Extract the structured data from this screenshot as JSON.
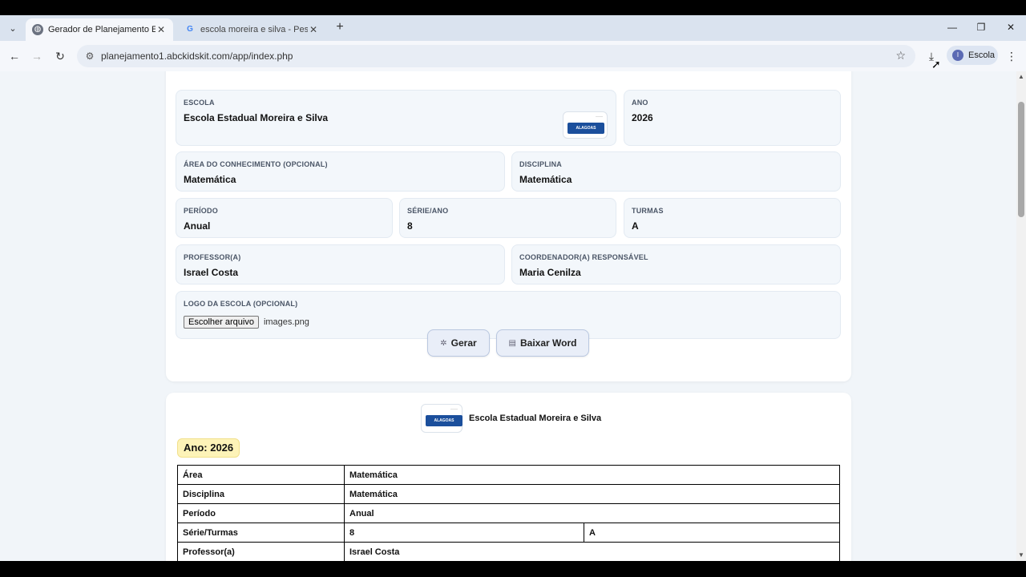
{
  "browser": {
    "tabs": [
      {
        "title": "Gerador de Planejamento Escolar",
        "icon": "globe-icon",
        "active": true
      },
      {
        "title": "escola moreira e silva - Pesquisa Google",
        "icon": "google-icon",
        "active": false
      }
    ],
    "url": "planejamento1.abckidskit.com/app/index.php",
    "profile_name": "Escola",
    "profile_initial": "I"
  },
  "form": {
    "escola": {
      "label": "ESCOLA",
      "value": "Escola Estadual Moreira e Silva"
    },
    "ano": {
      "label": "ANO",
      "value": "2026"
    },
    "area": {
      "label": "ÁREA DO CONHECIMENTO (OPCIONAL)",
      "value": "Matemática"
    },
    "disciplina": {
      "label": "DISCIPLINA",
      "value": "Matemática"
    },
    "periodo": {
      "label": "PERÍODO",
      "value": "Anual"
    },
    "serie": {
      "label": "SÉRIE/ANO",
      "value": "8"
    },
    "turmas": {
      "label": "TURMAS",
      "value": "A"
    },
    "professor": {
      "label": "PROFESSOR(A)",
      "value": "Israel Costa"
    },
    "coordenador": {
      "label": "COORDENADOR(A) RESPONSÁVEL",
      "value": "Maria Cenilza"
    },
    "logo": {
      "label": "LOGO DA ESCOLA (OPCIONAL)",
      "button": "Escolher arquivo",
      "filename": "images.png"
    },
    "logo_text": "ALAGOAS",
    "gerar_label": "Gerar",
    "baixar_label": "Baixar Word"
  },
  "preview": {
    "school_name": "Escola Estadual Moreira e Silva",
    "logo_text": "ALAGOAS",
    "year_label": "Ano: 2026",
    "rows": [
      {
        "key": "Área",
        "value": "Matemática"
      },
      {
        "key": "Disciplina",
        "value": "Matemática"
      },
      {
        "key": "Período",
        "value": "Anual"
      },
      {
        "key": "Série/Turmas",
        "value": "8",
        "value2": "A"
      },
      {
        "key": "Professor(a)",
        "value": "Israel Costa"
      }
    ]
  }
}
